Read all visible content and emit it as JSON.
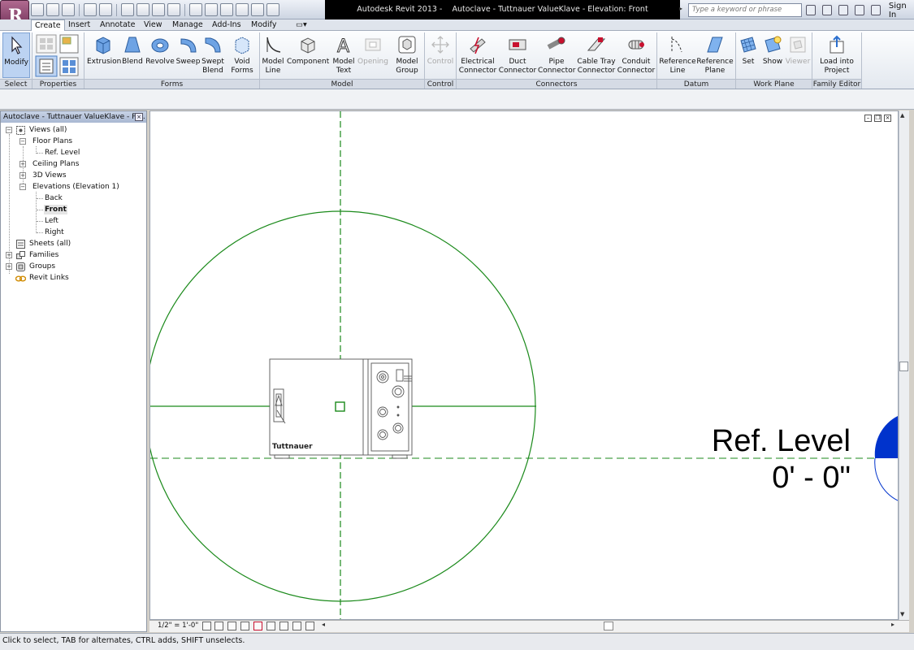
{
  "app": {
    "title": "Autodesk Revit 2013 -",
    "document_title": "Autoclave - Tuttnauer ValueKlave - Elevation: Front",
    "search_placeholder": "Type a keyword or phrase",
    "sign_in": "Sign In"
  },
  "tabs": [
    "Create",
    "Insert",
    "Annotate",
    "View",
    "Manage",
    "Add-Ins",
    "Modify"
  ],
  "ribbon": {
    "select": {
      "label": "Select",
      "modify": "Modify"
    },
    "properties": {
      "label": "Properties"
    },
    "forms": {
      "label": "Forms",
      "extrusion": "Extrusion",
      "blend": "Blend",
      "revolve": "Revolve",
      "sweep": "Sweep",
      "swept_blend_1": "Swept",
      "swept_blend_2": "Blend",
      "void_forms_1": "Void",
      "void_forms_2": "Forms"
    },
    "model": {
      "label": "Model",
      "model_line_1": "Model",
      "model_line_2": "Line",
      "component": "Component",
      "model_text_1": "Model",
      "model_text_2": "Text",
      "opening": "Opening",
      "model_group_1": "Model",
      "model_group_2": "Group"
    },
    "control": {
      "label": "Control",
      "control": "Control"
    },
    "connectors": {
      "label": "Connectors",
      "electrical_1": "Electrical",
      "electrical_2": "Connector",
      "duct_1": "Duct",
      "duct_2": "Connector",
      "pipe_1": "Pipe",
      "pipe_2": "Connector",
      "cable_1": "Cable Tray",
      "cable_2": "Connector",
      "conduit_1": "Conduit",
      "conduit_2": "Connector"
    },
    "datum": {
      "label": "Datum",
      "ref_line_1": "Reference",
      "ref_line_2": "Line",
      "ref_plane_1": "Reference",
      "ref_plane_2": "Plane"
    },
    "work_plane": {
      "label": "Work Plane",
      "set": "Set",
      "show": "Show",
      "viewer": "Viewer"
    },
    "family_editor": {
      "label": "Family Editor",
      "load_1": "Load into",
      "load_2": "Project"
    }
  },
  "project_browser": {
    "title": "Autoclave - Tuttnauer ValueKlave - Pr...",
    "items": {
      "views_all": "Views (all)",
      "floor_plans": "Floor Plans",
      "ref_level": "Ref. Level",
      "ceiling_plans": "Ceiling Plans",
      "views_3d": "3D Views",
      "elevations": "Elevations (Elevation 1)",
      "back": "Back",
      "front": "Front",
      "left": "Left",
      "right": "Right",
      "sheets": "Sheets (all)",
      "families": "Families",
      "groups": "Groups",
      "revit_links": "Revit Links"
    }
  },
  "drawing": {
    "level_name": "Ref. Level",
    "level_elevation": "0' - 0\"",
    "brand_label": "Tuttnauer",
    "colors": {
      "reference": "#1b8a1b",
      "level_head": "#0033cc",
      "drawing": "#555555"
    }
  },
  "view_control": {
    "scale": "1/2\" = 1'-0\""
  },
  "status": {
    "text": "Click to select, TAB for alternates, CTRL adds, SHIFT unselects."
  }
}
